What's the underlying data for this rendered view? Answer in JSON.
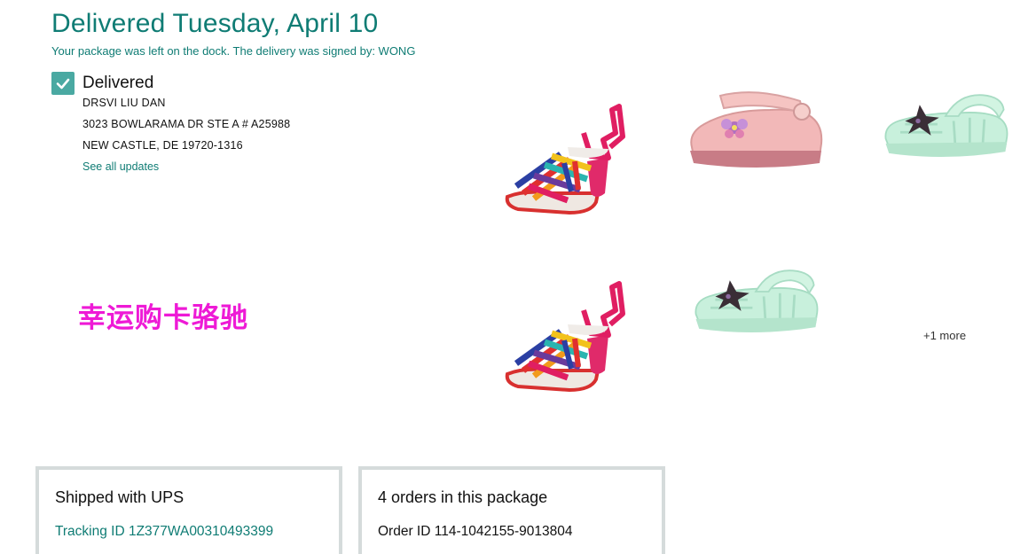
{
  "delivery": {
    "title": "Delivered Tuesday, April 10",
    "subtitle": "Your package was left on the dock. The delivery was signed by: WONG"
  },
  "status": {
    "label": "Delivered",
    "check_icon": "checkmark-icon",
    "address_lines": [
      "DRSVI LIU DAN",
      "3023 BOWLARAMA DR STE A # A25988",
      "NEW CASTLE, DE 19720-1316"
    ],
    "see_all_label": "See all updates"
  },
  "watermark": {
    "text": "幸运购卡骆驰"
  },
  "products": {
    "items": [
      {
        "name": "rainbow-strap-heel-sandal"
      },
      {
        "name": "pink-jelly-clog"
      },
      {
        "name": "mint-glitter-sandal"
      },
      {
        "name": "rainbow-strap-heel-sandal"
      },
      {
        "name": "mint-glitter-sandal"
      }
    ],
    "more_label": "+1 more"
  },
  "shipping": {
    "title": "Shipped with UPS",
    "tracking": "Tracking ID 1Z377WA00310493399"
  },
  "orders": {
    "title": "4 orders in this package",
    "order_id": "Order ID 114-1042155-9013804"
  },
  "colors": {
    "accent": "#0f7c74",
    "check_bg": "#4aa9a2",
    "watermark": "#ee1ad6",
    "card_border": "#d5dbdb"
  }
}
